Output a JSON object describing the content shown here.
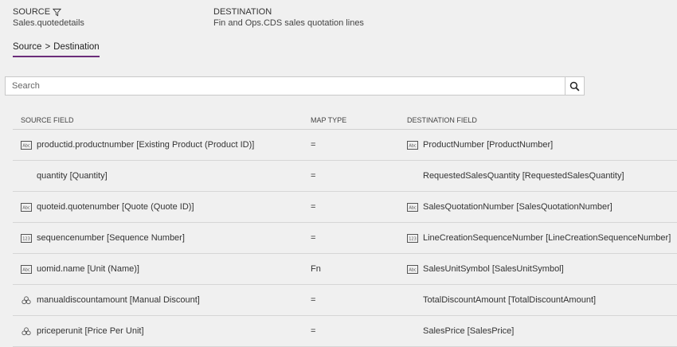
{
  "header": {
    "source_label": "SOURCE",
    "source_value": "Sales.quotedetails",
    "destination_label": "DESTINATION",
    "destination_value": "Fin and Ops.CDS sales quotation lines"
  },
  "breadcrumb": {
    "first": "Source",
    "separator": ">",
    "second": "Destination"
  },
  "search": {
    "placeholder": "Search"
  },
  "table": {
    "columns": {
      "source": "SOURCE FIELD",
      "map": "MAP TYPE",
      "dest": "DESTINATION FIELD"
    },
    "rows": [
      {
        "src_icon": "abc-icon",
        "source": "productid.productnumber [Existing Product (Product ID)]",
        "map": "=",
        "dst_icon": "abc-icon",
        "dest": "ProductNumber [ProductNumber]"
      },
      {
        "src_icon": "",
        "source": "quantity [Quantity]",
        "map": "=",
        "dst_icon": "",
        "dest": "RequestedSalesQuantity [RequestedSalesQuantity]"
      },
      {
        "src_icon": "abc-icon",
        "source": "quoteid.quotenumber [Quote (Quote ID)]",
        "map": "=",
        "dst_icon": "abc-icon",
        "dest": "SalesQuotationNumber [SalesQuotationNumber]"
      },
      {
        "src_icon": "number-icon",
        "source": "sequencenumber [Sequence Number]",
        "map": "=",
        "dst_icon": "number-icon",
        "dest": "LineCreationSequenceNumber [LineCreationSequenceNumber]"
      },
      {
        "src_icon": "abc-icon",
        "source": "uomid.name [Unit (Name)]",
        "map": "Fn",
        "dst_icon": "abc-icon",
        "dest": "SalesUnitSymbol [SalesUnitSymbol]"
      },
      {
        "src_icon": "currency-icon",
        "source": "manualdiscountamount [Manual Discount]",
        "map": "=",
        "dst_icon": "",
        "dest": "TotalDiscountAmount [TotalDiscountAmount]"
      },
      {
        "src_icon": "currency-icon",
        "source": "priceperunit [Price Per Unit]",
        "map": "=",
        "dst_icon": "",
        "dest": "SalesPrice [SalesPrice]"
      }
    ]
  }
}
